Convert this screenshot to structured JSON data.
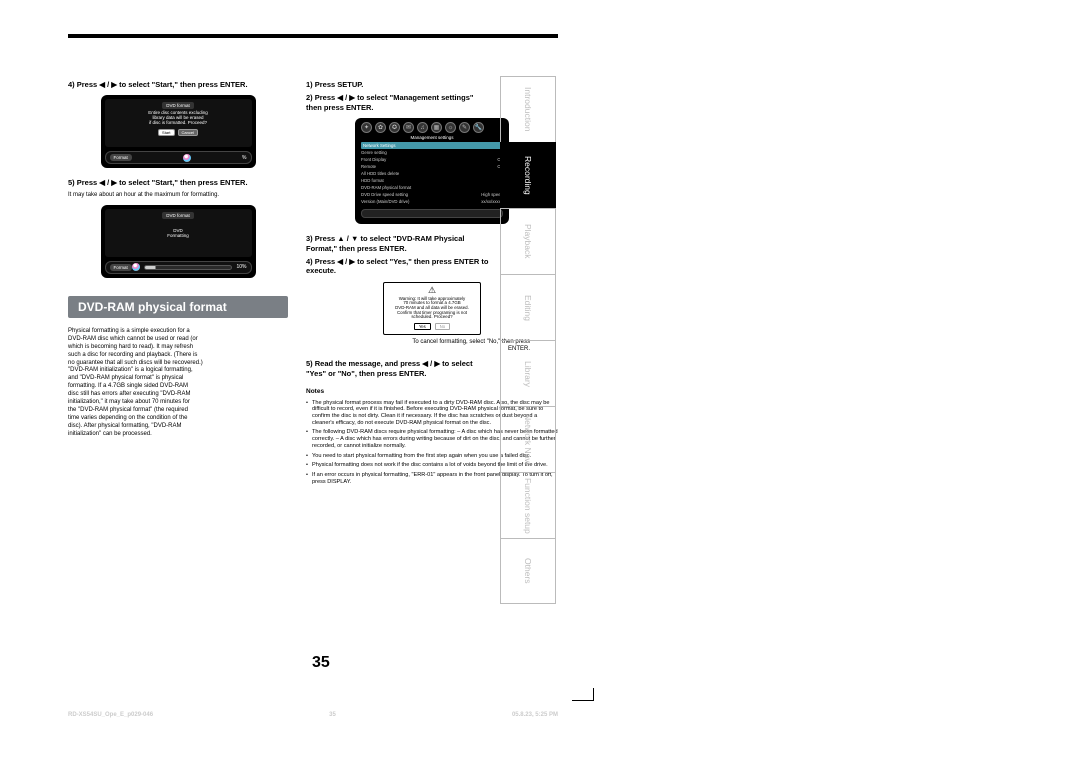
{
  "side_tabs": [
    "Introduction",
    "Recording",
    "Playback",
    "Editing",
    "Library",
    "Network Navi",
    "Function setup",
    "Others"
  ],
  "side_active": "Recording",
  "page_number": "35",
  "footer_left": "RD-XS54SU_Ope_E_p029-046",
  "footer_mid": "35",
  "footer_right": "05.8.23, 5:25 PM",
  "left": {
    "step4": "4)  Press ◀ / ▶ to select \"Start,\" then press ENTER.",
    "osd1": {
      "title": "DVD format",
      "body1": "Entire disc contents excluding",
      "body2": "library data will be erased",
      "body3": "if disc is formatted. Proceed?",
      "btn_start": "Start",
      "btn_cancel": "Cancel",
      "bar": "Format",
      "pct": "%"
    },
    "step5": "5)  Press ◀ / ▶ to select \"Start,\" then press ENTER.",
    "note5": "It may take about an hour at the maximum for formatting.",
    "osd2": {
      "title": "DVD format",
      "body1": "DVD",
      "body2": "Formatting",
      "bar": "Format",
      "pct": "10%"
    },
    "section": "DVD-RAM physical format",
    "intro_title": " ",
    "intro": [
      "Physical formatting is a simple execution for a",
      "DVD-RAM disc which cannot be used or read (or",
      "which is becoming hard to read). It may refresh",
      "such a disc for recording and playback. (There is",
      "no guarantee that all such discs will be recovered.)",
      "\"DVD-RAM initialization\" is a logical formatting,",
      "and \"DVD-RAM physical format\" is physical",
      "formatting. If a 4.7GB single sided DVD-RAM",
      "disc still has errors after executing \"DVD-RAM",
      "initialization,\" it may take about 70 minutes for",
      "the \"DVD-RAM physical format\" (the required",
      "time varies depending on the condition of the",
      "disc). After physical formatting, \"DVD-RAM",
      "initialization\" can be processed."
    ]
  },
  "right": {
    "step1": "1)  Press SETUP.",
    "step2a": "2)  Press ◀ / ▶ to select \"Management settings\"",
    "step2b": "     then press ENTER.",
    "mgmt_title": "Management settings",
    "mgmt_rows": [
      {
        "l": "Network Settings",
        "r": ""
      },
      {
        "l": "Genre setting",
        "r": ""
      },
      {
        "l": "Front Display",
        "r": "Off"
      },
      {
        "l": "Remote",
        "r": "Off"
      },
      {
        "l": "All HDD titles delete",
        "r": ""
      },
      {
        "l": "HDD format",
        "r": ""
      },
      {
        "l": "DVD-RAM physical format",
        "r": ""
      },
      {
        "l": "DVD Drive speed setting",
        "r": "High speed"
      },
      {
        "l": "Version (Main/DVD drive)",
        "r": "xx/xx/xxxxx"
      }
    ],
    "step3a": "3)  Press ▲ / ▼ to select \"DVD-RAM Physical",
    "step3b": "     Format,\" then press ENTER.",
    "step4a": "4)  Press ◀ / ▶ to select \"Yes,\" then press ENTER to",
    "step4b": "     execute.",
    "warn": {
      "l1": "Warning: It will take approximately",
      "l2": "70 minutes to format a 4.7GB",
      "l3": "DVD-RAM and all data will be erased.",
      "l4": "Confirm that timer programing is not",
      "l5": "scheduled. Proceed?",
      "yes": "Yes",
      "no": "No"
    },
    "ecer": "To cancel formatting, select \"No,\" then press",
    "ecer2": "ENTER.",
    "step5a": "5)  Read the message, and press ◀ / ▶ to select",
    "step5b": "     \"Yes\" or \"No\", then press ENTER.",
    "notes_hdr": "Notes",
    "notes": [
      "The physical format process may fail if executed to a dirty DVD-RAM disc. Also, the disc may be difficult to record, even if it is finished. Before executing DVD-RAM physical format, be sure to confirm the disc is not dirty. Clean it if necessary. If the disc has scratches or dust beyond a cleaner's efficacy, do not execute DVD-RAM physical format on the disc.",
      "The following DVD-RAM discs require physical formatting: – A disc which has never been formatted correctly. – A disc which has errors during writing because of dirt on the disc, and cannot be further recorded, or cannot initialize normally.",
      "You need to start physical formatting from the first step again when you use a failed disc.",
      "Physical formatting does not work if the disc contains a lot of voids beyond the limit of the drive.",
      "If an error occurs in physical formatting, \"ERR-01\" appears in the front panel display. To turn it off, press DISPLAY."
    ]
  }
}
